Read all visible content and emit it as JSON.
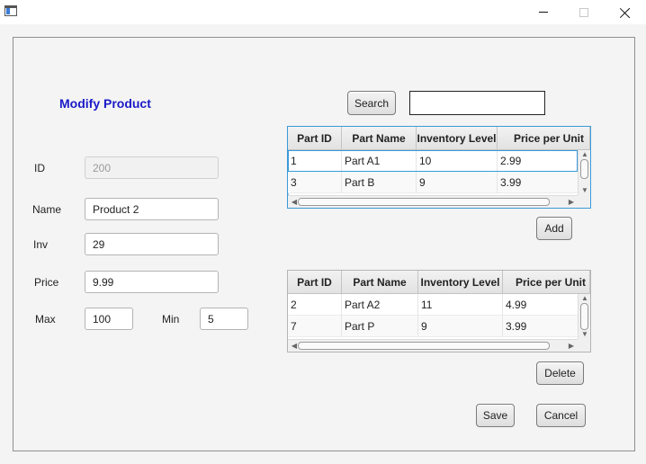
{
  "window": {
    "title": "",
    "controls": {
      "minimize_icon": "minimize-icon",
      "maximize_icon": "maximize-icon",
      "close_icon": "close-icon"
    }
  },
  "form": {
    "heading": "Modify Product",
    "id_label": "ID",
    "id_value": "200",
    "name_label": "Name",
    "name_value": "Product 2",
    "inv_label": "Inv",
    "inv_value": "29",
    "price_label": "Price",
    "price_value": "9.99",
    "max_label": "Max",
    "max_value": "100",
    "min_label": "Min",
    "min_value": "5"
  },
  "search": {
    "button_label": "Search",
    "value": ""
  },
  "parts_table": {
    "headers": [
      "Part ID",
      "Part Name",
      "Inventory Level",
      "Price per Unit"
    ],
    "rows": [
      [
        "1",
        "Part A1",
        "10",
        "2.99"
      ],
      [
        "3",
        "Part B",
        "9",
        "3.99"
      ]
    ],
    "selected_row": 0
  },
  "add_button_label": "Add",
  "associated_table": {
    "headers": [
      "Part ID",
      "Part Name",
      "Inventory Level",
      "Price per Unit"
    ],
    "rows": [
      [
        "2",
        "Part A2",
        "11",
        "4.99"
      ],
      [
        "7",
        "Part P",
        "9",
        "3.99"
      ]
    ]
  },
  "delete_button_label": "Delete",
  "save_button_label": "Save",
  "cancel_button_label": "Cancel",
  "colors": {
    "heading": "#1a1ac8",
    "focus_border": "#3a9ad9"
  }
}
